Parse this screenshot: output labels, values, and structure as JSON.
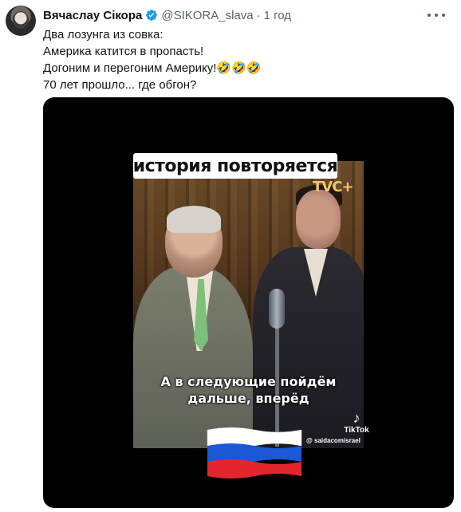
{
  "tweet": {
    "author_name": "Вячаслау Сікора",
    "handle": "@SIKORA_slava",
    "separator": "·",
    "time": "1 год",
    "lines": [
      "Два лозунга из совка:",
      "Америка катится в пропасть!",
      "Догоним и перегоним Америку!🤣🤣🤣",
      "70 лет прошло... где обгон?"
    ]
  },
  "media": {
    "caption_top": "история повторяется",
    "subtitle_line1": "А в следующие пойдём",
    "subtitle_line2": "дальше, вперёд",
    "channel_logo": "ТVС+",
    "tiktok_label": "TikTok",
    "tiktok_handle": "@ saidacomisrael",
    "flag_colors": [
      "#ffffff",
      "#1c57d6",
      "#e3262e"
    ]
  },
  "colors": {
    "verified": "#1d9bf0",
    "secondary_text": "#536471",
    "primary_text": "#0f1419"
  },
  "icons": {
    "verified": "verified-badge-icon",
    "more": "more-dots-icon",
    "tiktok": "tiktok-logo-icon"
  }
}
